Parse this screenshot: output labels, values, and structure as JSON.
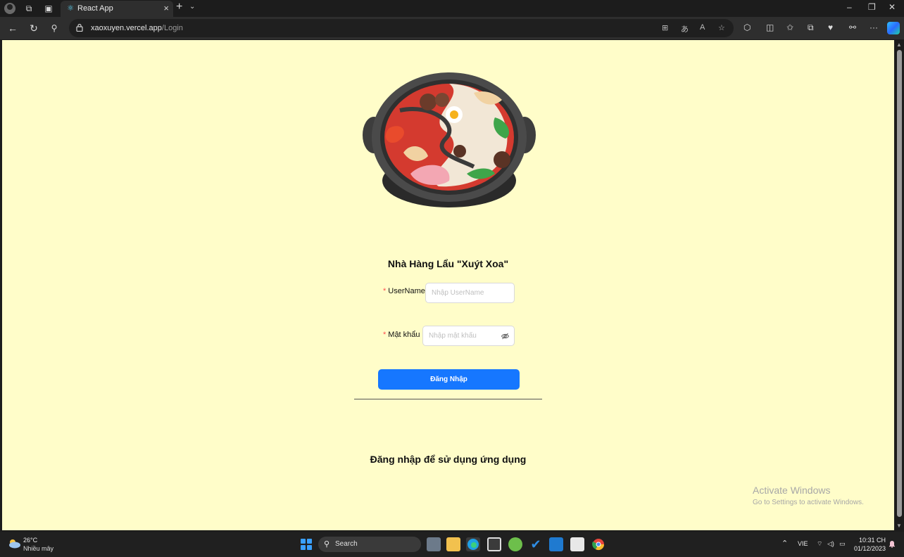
{
  "browser": {
    "tab_title": "React App",
    "url_host": "xaoxuyen.vercel.app",
    "url_path": "/Login"
  },
  "page": {
    "brand_title": "Nhà Hàng Lẩu \"Xuýt Xoa\"",
    "username_label": "UserName",
    "username_placeholder": "Nhập UserName",
    "password_label": "Mật khẩu",
    "password_placeholder": "Nhập mật khẩu",
    "login_button": "Đăng Nhập",
    "tagline": "Đăng nhập để sử dụng ứng dụng"
  },
  "watermark": {
    "line1": "Activate Windows",
    "line2": "Go to Settings to activate Windows."
  },
  "taskbar": {
    "temperature": "26°C",
    "weather_desc": "Nhiều mây",
    "search_label": "Search",
    "language": "VIE",
    "time": "10:31 CH",
    "date": "01/12/2023"
  },
  "colors": {
    "page_bg": "#fffdc9",
    "primary": "#1677ff",
    "required": "#ff4d4f"
  }
}
